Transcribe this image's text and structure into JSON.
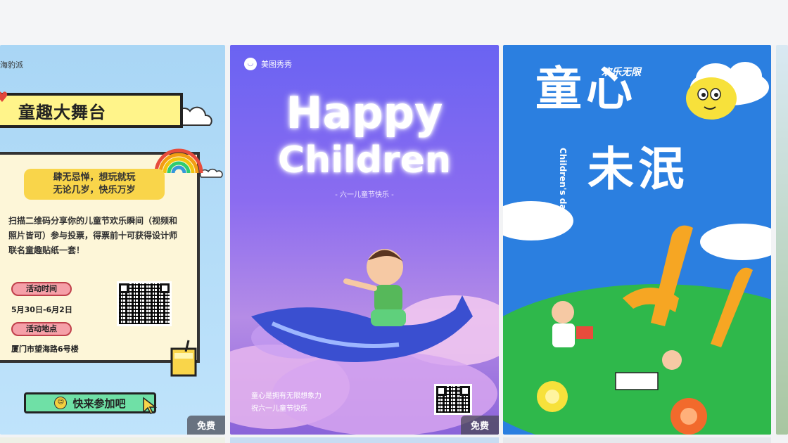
{
  "cards": [
    {
      "brand": "海豹派",
      "title": "童趣大舞台",
      "slogan_line1": "肆无忌惮，想玩就玩",
      "slogan_line2": "无论几岁，快乐万岁",
      "description": "扫描二维码分享你的儿童节欢乐瞬间（视频和照片皆可）参与投票，得票前十可获得设计师联名童趣贴纸一套！",
      "time_label": "活动时间",
      "time_value": "5月30日-6月2日",
      "place_label": "活动地点",
      "place_value": "厦门市望海路6号楼",
      "cta": "快来参加吧",
      "badge": "免费"
    },
    {
      "brand": "美图秀秀",
      "headline_line1": "Happy",
      "headline_line2": "Children",
      "subtitle": "- 六一儿童节快乐 -",
      "footer_line1": "童心是拥有无限想象力",
      "footer_line2": "祝六一儿童节快乐",
      "badge": "免费"
    },
    {
      "tagline": "欢乐无限",
      "title_line1": "童心",
      "title_line2": "未泯",
      "vertical_text": "Children's day",
      "number": "61"
    }
  ],
  "colors": {
    "card1_bg": "#a9d6f5",
    "card2_accent": "#6a63f2",
    "card3_bg": "#2b7fe0",
    "badge_bg": "#464650"
  }
}
